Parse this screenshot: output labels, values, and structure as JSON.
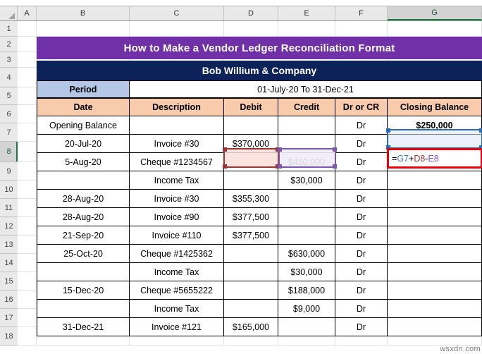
{
  "app": {
    "type": "spreadsheet",
    "watermark": "wsxdn.com"
  },
  "grid": {
    "column_headers": [
      "A",
      "B",
      "C",
      "D",
      "E",
      "F",
      "G"
    ],
    "selected_column": "G",
    "row_headers": [
      "1",
      "2",
      "3",
      "4",
      "5",
      "6",
      "7",
      "8",
      "9",
      "10",
      "11",
      "12",
      "13",
      "14",
      "15",
      "16",
      "17",
      "18"
    ],
    "selected_row": "8"
  },
  "colors": {
    "title_banner": "#7030A8",
    "company_header": "#0D2259",
    "period_label": "#B4C7E7",
    "table_header": "#F8CBAD",
    "selection_blue": "#2B6CB8",
    "ref_red": "#9C3336",
    "ref_purple": "#7B57B0",
    "edit_border_red": "#E8000B",
    "sheet_accent_green": "#1A7A45"
  },
  "title_banner": {
    "text": "How to Make a Vendor Ledger Reconciliation Format"
  },
  "company": {
    "name": "Bob Willium & Company"
  },
  "period": {
    "label": "Period",
    "value": "01-July-20 To 31-Dec-21"
  },
  "table": {
    "headers": [
      "Date",
      "Description",
      "Debit",
      "Credit",
      "Dr or CR",
      "Closing Balance"
    ],
    "rows": [
      {
        "date": "Opening Balance",
        "description": "",
        "debit": "",
        "credit": "",
        "drcr": "Dr",
        "balance": "$250,000",
        "balance_bold": true
      },
      {
        "date": "20-Jul-20",
        "description": "Invoice #30",
        "debit": "$370,000",
        "credit": "",
        "drcr": "Dr",
        "balance": "",
        "balance_bold": false
      },
      {
        "date": "5-Aug-20",
        "description": "Cheque #1234567",
        "debit": "",
        "credit": "$450,000",
        "drcr": "Dr",
        "balance": "",
        "balance_bold": false
      },
      {
        "date": "",
        "description": "Income Tax",
        "debit": "",
        "credit": "$30,000",
        "drcr": "Dr",
        "balance": "",
        "balance_bold": false
      },
      {
        "date": "28-Aug-20",
        "description": "Invoice #30",
        "debit": "$355,300",
        "credit": "",
        "drcr": "Dr",
        "balance": "",
        "balance_bold": false
      },
      {
        "date": "28-Aug-20",
        "description": "Invoice #90",
        "debit": "$377,500",
        "credit": "",
        "drcr": "Dr",
        "balance": "",
        "balance_bold": false
      },
      {
        "date": "21-Sep-20",
        "description": "Invoice #110",
        "debit": "$377,500",
        "credit": "",
        "drcr": "Dr",
        "balance": "",
        "balance_bold": false
      },
      {
        "date": "25-Oct-20",
        "description": "Cheque #1425362",
        "debit": "",
        "credit": "$630,000",
        "drcr": "Dr",
        "balance": "",
        "balance_bold": false
      },
      {
        "date": "",
        "description": "Income Tax",
        "debit": "",
        "credit": "$30,000",
        "drcr": "Dr",
        "balance": "",
        "balance_bold": false
      },
      {
        "date": "15-Dec-20",
        "description": "Cheque #5655222",
        "debit": "",
        "credit": "$188,000",
        "drcr": "Dr",
        "balance": "",
        "balance_bold": false
      },
      {
        "date": "",
        "description": "Income Tax",
        "debit": "",
        "credit": "$9,000",
        "drcr": "Dr",
        "balance": "",
        "balance_bold": false
      },
      {
        "date": "31-Dec-21",
        "description": "Invoice #121",
        "debit": "$165,000",
        "credit": "",
        "drcr": "Dr",
        "balance": "",
        "balance_bold": false
      }
    ]
  },
  "active_cell": {
    "reference": "G8",
    "formula_parts": {
      "equals": "=",
      "ref1": "G7",
      "op1": "+",
      "ref2": "D8",
      "op2": "-",
      "ref3": "E8"
    },
    "formula_full": "=G7+D8-E8"
  },
  "highlighted_cells": {
    "g7_value": "$250,000",
    "d8_value": "$370,000",
    "e8_value": ""
  }
}
